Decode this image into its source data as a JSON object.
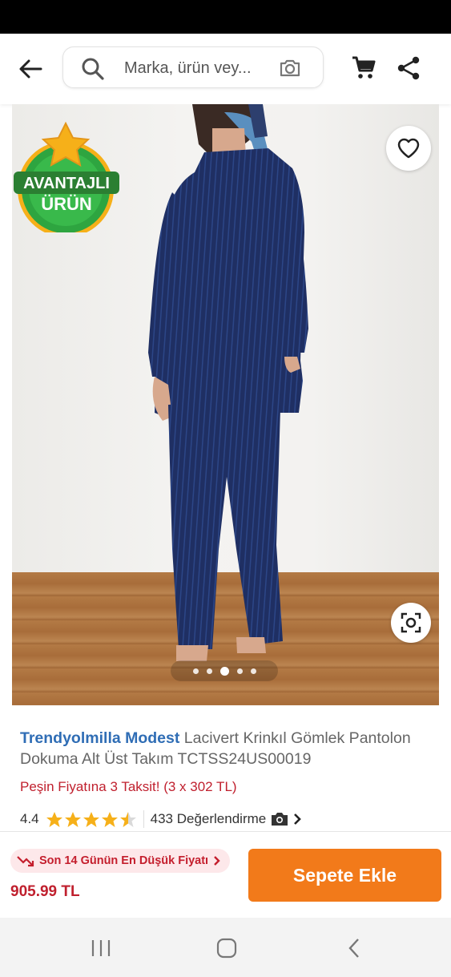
{
  "header": {
    "search_placeholder": "Marka, ürün vey...",
    "icons": [
      "back-arrow-icon",
      "search-icon",
      "camera-icon",
      "cart-icon",
      "share-icon"
    ]
  },
  "gallery": {
    "badge_text": [
      "AVANTAJLI",
      "ÜRÜN"
    ],
    "image_count": 5,
    "active_index": 2,
    "icons": [
      "heart-icon",
      "visual-search-icon"
    ]
  },
  "product": {
    "brand": "Trendyolmilla Modest",
    "name": " Lacivert Krinkıl Gömlek Pantolon Dokuma Alt Üst Takım TCTSS24US00019",
    "installment": "Peşin Fiyatına 3 Taksit! (3 x 302 TL)",
    "rating": "4.4",
    "rating_value": 4.4,
    "reviews": "433 Değerlendirme"
  },
  "purchase": {
    "low_price_label": "Son 14 Günün En Düşük Fiyatı",
    "price": "905.99 TL",
    "add_to_cart": "Sepete Ekle"
  },
  "colors": {
    "accent": "#f27a1a",
    "brand_blue": "#2f6db5",
    "price_red": "#c0202e",
    "star": "#f6b019",
    "outfit_navy": "#1f2f63"
  }
}
